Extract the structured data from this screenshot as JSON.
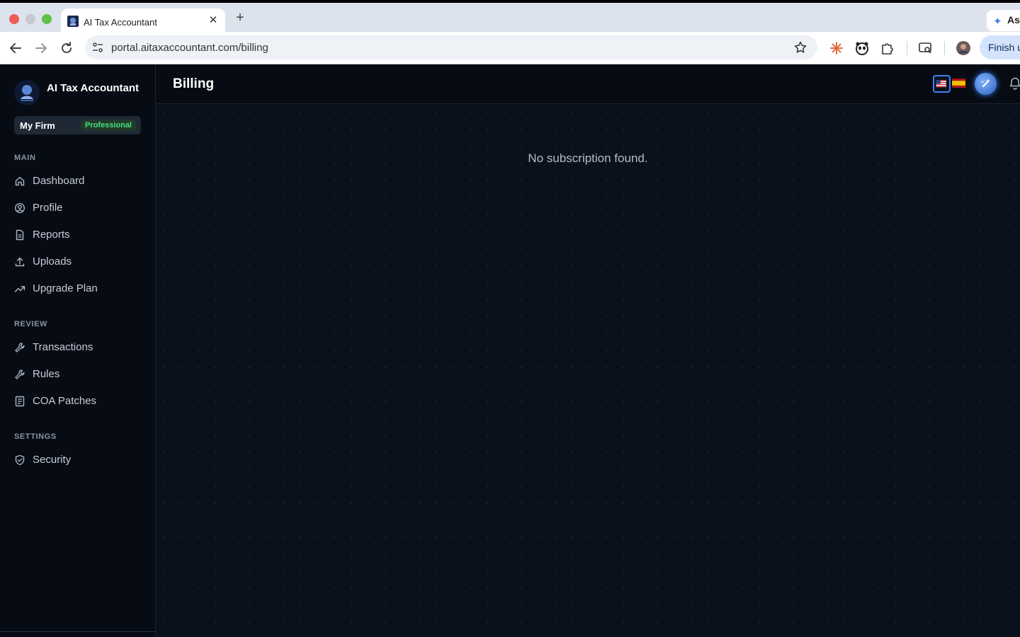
{
  "browser": {
    "tab_title": "AI Tax Accountant",
    "url": "portal.aitaxaccountant.com/billing",
    "side_tab_label": "As",
    "finish_label": "Finish u"
  },
  "sidebar": {
    "brand": "AI Tax Accountant",
    "firm_name": "My Firm",
    "firm_plan": "Professional",
    "sections": [
      {
        "title": "MAIN",
        "items": [
          {
            "label": "Dashboard",
            "icon": "home-icon"
          },
          {
            "label": "Profile",
            "icon": "user-circle-icon"
          },
          {
            "label": "Reports",
            "icon": "document-icon"
          },
          {
            "label": "Uploads",
            "icon": "upload-icon"
          },
          {
            "label": "Upgrade Plan",
            "icon": "trending-up-icon"
          }
        ]
      },
      {
        "title": "REVIEW",
        "items": [
          {
            "label": "Transactions",
            "icon": "wrench-icon"
          },
          {
            "label": "Rules",
            "icon": "wrench-icon"
          },
          {
            "label": "COA Patches",
            "icon": "list-icon"
          }
        ]
      },
      {
        "title": "SETTINGS",
        "items": [
          {
            "label": "Security",
            "icon": "shield-icon"
          }
        ]
      }
    ]
  },
  "header": {
    "title": "Billing"
  },
  "main": {
    "empty_message": "No subscription found."
  },
  "colors": {
    "sidebar_bg": "#070b13",
    "main_bg": "#0b111c",
    "accent": "#3b82f6",
    "badge_text": "#4ade80"
  }
}
